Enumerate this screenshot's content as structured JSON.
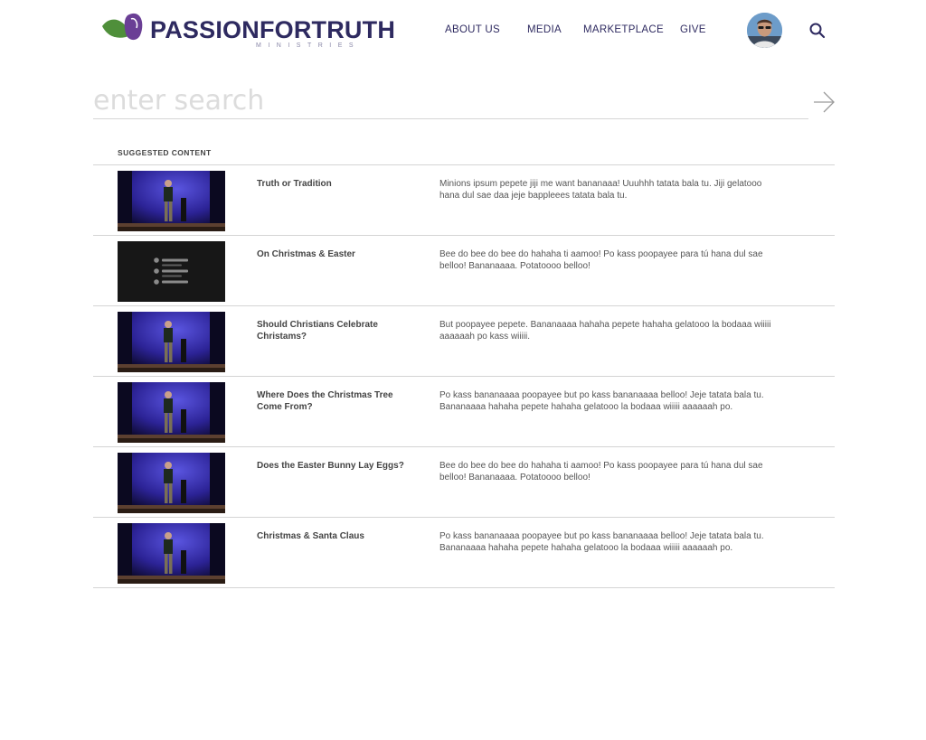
{
  "brand": {
    "name_part1": "PASSION",
    "name_part2": "FOR",
    "name_part3": "TRUTH",
    "subtitle": "MINISTRIES",
    "colors": {
      "navy": "#2e2a60",
      "green": "#4f8f3a",
      "purple": "#6a3f95"
    }
  },
  "nav": {
    "items": [
      {
        "label": "ABOUT US"
      },
      {
        "label": "MEDIA"
      },
      {
        "label": "MARKETPLACE"
      },
      {
        "label": "GIVE"
      }
    ],
    "search_icon": "search-icon",
    "avatar_icon": "user-avatar"
  },
  "search": {
    "placeholder": "enter search",
    "value": "",
    "submit_icon": "arrow-right-icon"
  },
  "suggested": {
    "label": "SUGGESTED CONTENT",
    "items": [
      {
        "title": "Truth or Tradition",
        "description": "Minions ipsum pepete jiji me want bananaaa! Uuuhhh tatata bala tu. Jiji gelatooo hana dul sae daa jeje bappleees tatata bala tu.",
        "thumb": "video-thumbnail"
      },
      {
        "title": "On Christmas & Easter",
        "description": "Bee do bee do bee do hahaha ti aamoo! Po kass poopayee para tú hana dul sae belloo! Bananaaaa. Potatoooo belloo!",
        "thumb": "article-list-thumbnail"
      },
      {
        "title": "Should Christians Celebrate Christams?",
        "description": "But poopayee pepete. Bananaaaa hahaha pepete hahaha gelatooo la bodaaa wiiiii aaaaaah po kass wiiiii.",
        "thumb": "video-thumbnail"
      },
      {
        "title": "Where Does the Christmas Tree Come From?",
        "description": "Po kass bananaaaa poopayee but po kass bananaaaa belloo! Jeje tatata bala tu. Bananaaaa hahaha pepete hahaha gelatooo la bodaaa wiiiii aaaaaah po.",
        "thumb": "video-thumbnail"
      },
      {
        "title": "Does the Easter Bunny Lay Eggs?",
        "description": "Bee do bee do bee do hahaha ti aamoo! Po kass poopayee para tú hana dul sae belloo! Bananaaaa. Potatoooo belloo!",
        "thumb": "video-thumbnail"
      },
      {
        "title": "Christmas & Santa Claus",
        "description": "Po kass bananaaaa poopayee but po kass bananaaaa belloo! Jeje tatata bala tu. Bananaaaa hahaha pepete hahaha gelatooo la bodaaa wiiiii aaaaaah po.",
        "thumb": "video-thumbnail"
      }
    ]
  }
}
